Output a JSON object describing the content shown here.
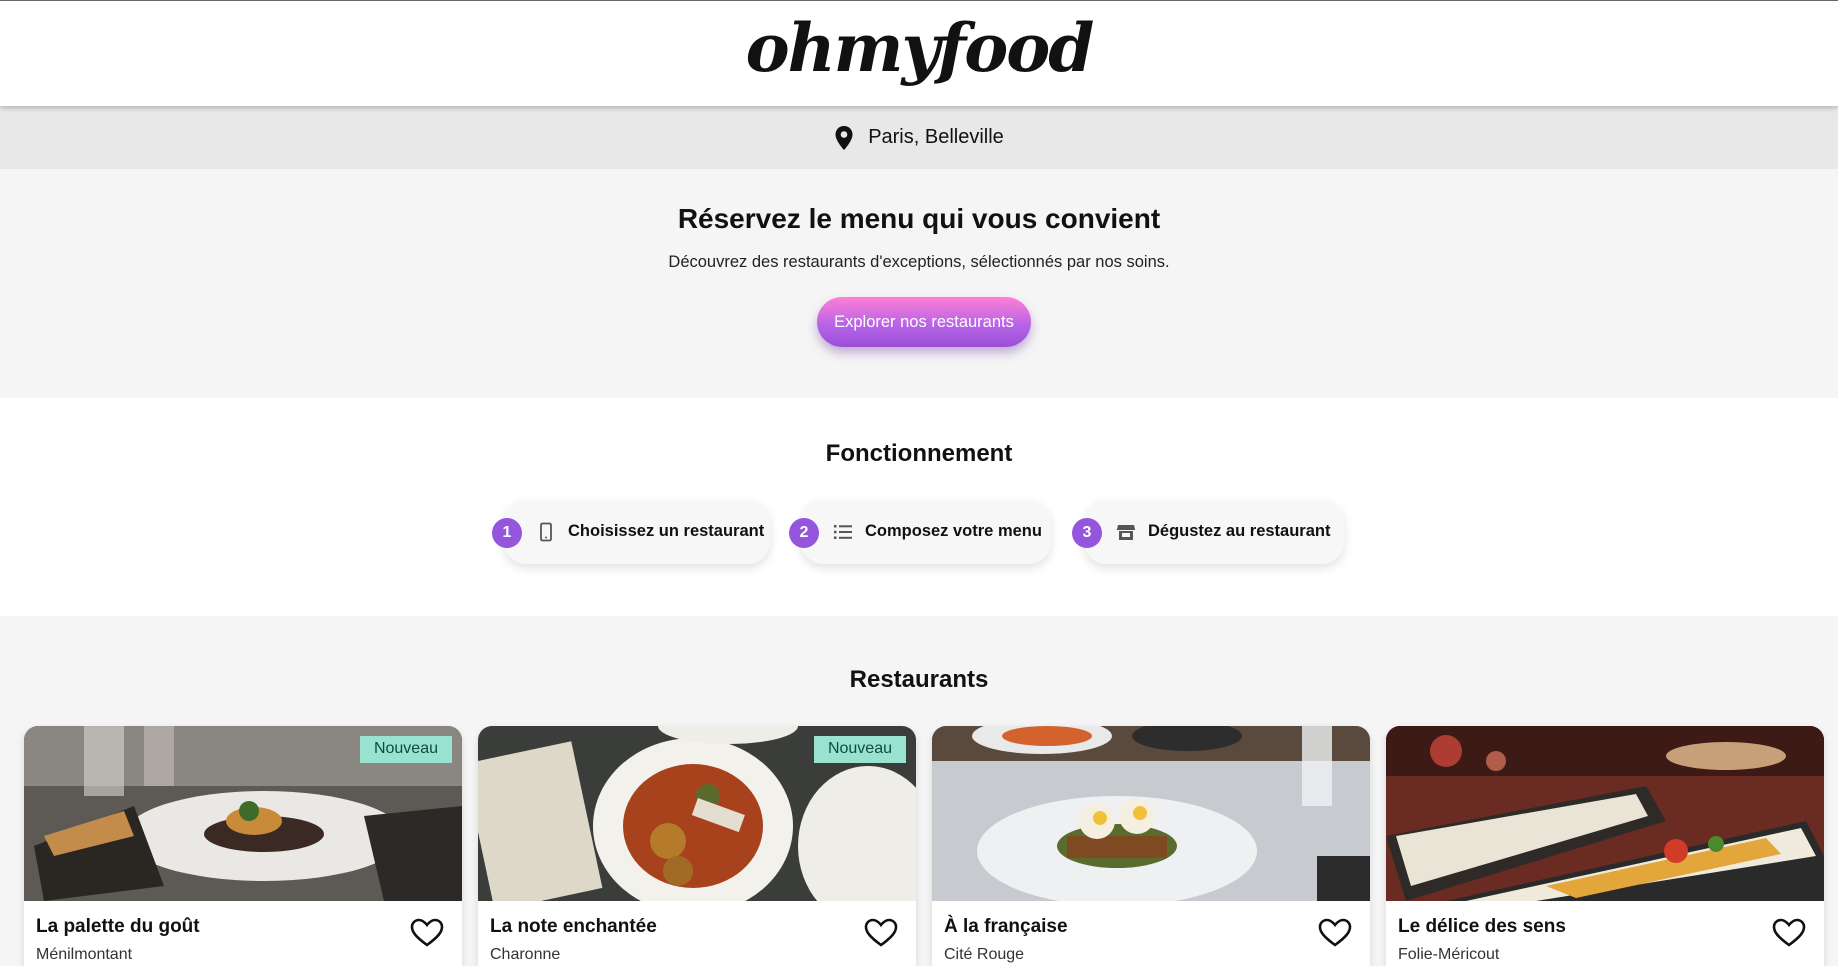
{
  "header": {
    "logo": "ohmyfood"
  },
  "location": {
    "text": "Paris, Belleville",
    "icon": "location-pin-icon"
  },
  "hero": {
    "title": "Réservez le menu qui vous convient",
    "subtitle": "Découvrez des restaurants d'exceptions, sélectionnés par nos soins.",
    "cta": "Explorer nos restaurants"
  },
  "how": {
    "title": "Fonctionnement",
    "steps": [
      {
        "num": "1",
        "label": "Choisissez un restaurant",
        "icon": "phone-icon"
      },
      {
        "num": "2",
        "label": "Composez votre menu",
        "icon": "list-icon"
      },
      {
        "num": "3",
        "label": "Dégustez au restaurant",
        "icon": "store-icon"
      }
    ]
  },
  "restaurants": {
    "title": "Restaurants",
    "cards": [
      {
        "name": "La palette du goût",
        "area": "Ménilmontant",
        "badge": "Nouveau"
      },
      {
        "name": "La note enchantée",
        "area": "Charonne",
        "badge": "Nouveau"
      },
      {
        "name": "À la française",
        "area": "Cité Rouge",
        "badge": ""
      },
      {
        "name": "Le délice des sens",
        "area": "Folie-Méricout",
        "badge": ""
      }
    ]
  },
  "colors": {
    "accent": "#9356dc",
    "cta_top": "#ff7fd6",
    "cta_bottom": "#9a4fd8",
    "badge": "#99e2d0"
  }
}
